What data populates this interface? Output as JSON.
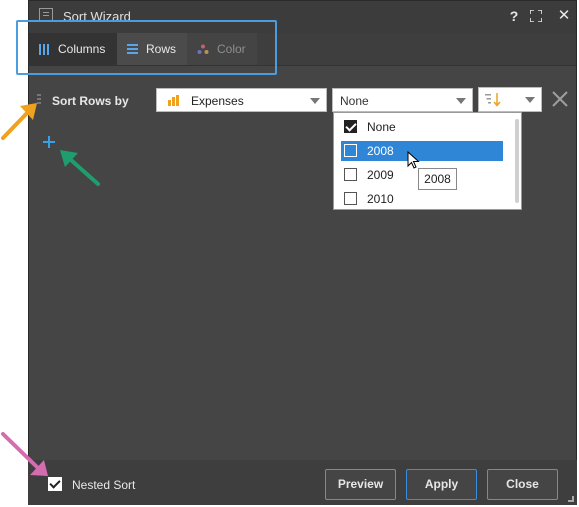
{
  "window": {
    "title": "Sort Wizard",
    "help": "?",
    "close": "✕"
  },
  "tabs": [
    {
      "label": "Columns"
    },
    {
      "label": "Rows"
    },
    {
      "label": "Color"
    }
  ],
  "sort_row": {
    "label": "Sort Rows by",
    "field": "Expenses",
    "member": "None"
  },
  "dropdown": {
    "options": [
      {
        "label": "None",
        "checked": true
      },
      {
        "label": "2008",
        "checked": false
      },
      {
        "label": "2009",
        "checked": false
      },
      {
        "label": "2010",
        "checked": false
      }
    ],
    "tooltip": "2008"
  },
  "footer": {
    "nested_label": "Nested Sort",
    "preview_label": "Preview",
    "apply_label": "Apply",
    "close_label": "Close"
  },
  "colors": {
    "accent": "#2f86d6",
    "callout_blue": "#4a9ee0",
    "callout_orange": "#f0a11e",
    "callout_green": "#1e9e6e",
    "callout_pink": "#d46cb0"
  }
}
